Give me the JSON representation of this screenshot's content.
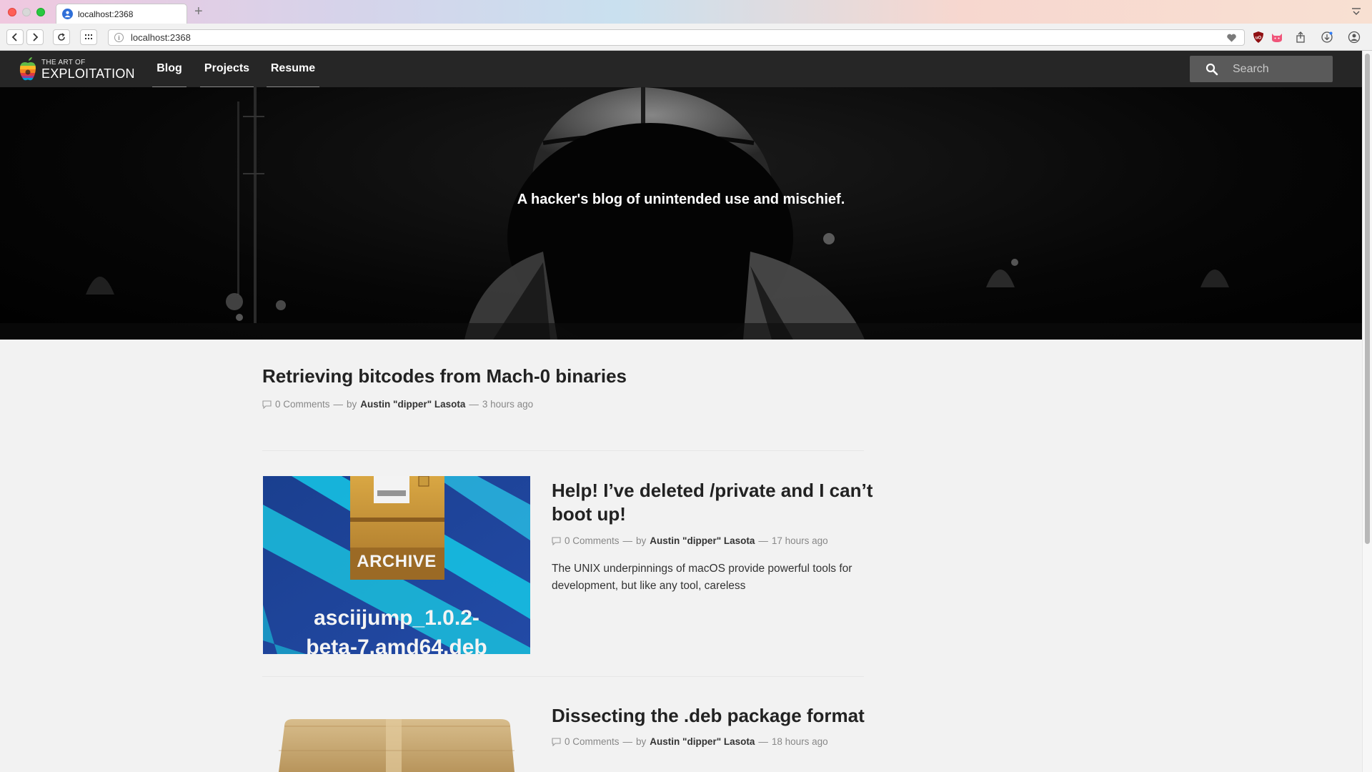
{
  "browser": {
    "tab_title": "localhost:2368",
    "new_tab": "+",
    "url": "localhost:2368",
    "url_info": "i"
  },
  "site": {
    "logo_top": "THE ART OF",
    "logo_bottom": "EXPLOITATION",
    "nav": [
      {
        "label": "Blog"
      },
      {
        "label": "Projects"
      },
      {
        "label": "Resume"
      }
    ],
    "search_placeholder": "Search",
    "tagline": "A hacker's blog of unintended use and mischief."
  },
  "posts": [
    {
      "title": "Retrieving bitcodes from Mach-0 binaries",
      "comments": "0 Comments",
      "sep1": "—",
      "by": "by",
      "author": "Austin \"dipper\" Lasota",
      "sep2": "—",
      "time": "3 hours ago"
    },
    {
      "title": "Help! I’ve deleted /private and I can’t boot up!",
      "comments": "0 Comments",
      "sep1": "—",
      "by": "by",
      "author": "Austin \"dipper\" Lasota",
      "sep2": "—",
      "time": "17 hours ago",
      "excerpt": "The UNIX underpinnings of macOS provide powerful tools for development, but like any tool, careless",
      "thumb_label": "ARCHIVE",
      "thumb_file_line1": "asciijump_1.0.2-",
      "thumb_file_line2": "beta-7.amd64.deb"
    },
    {
      "title": "Dissecting the .deb package format",
      "comments": "0 Comments",
      "sep1": "—",
      "by": "by",
      "author": "Austin \"dipper\" Lasota",
      "sep2": "—",
      "time": "18 hours ago"
    }
  ],
  "colors": {
    "nav_bg": "#262626",
    "page_bg": "#f2f2f2",
    "search_bg": "#5a5a5a"
  }
}
